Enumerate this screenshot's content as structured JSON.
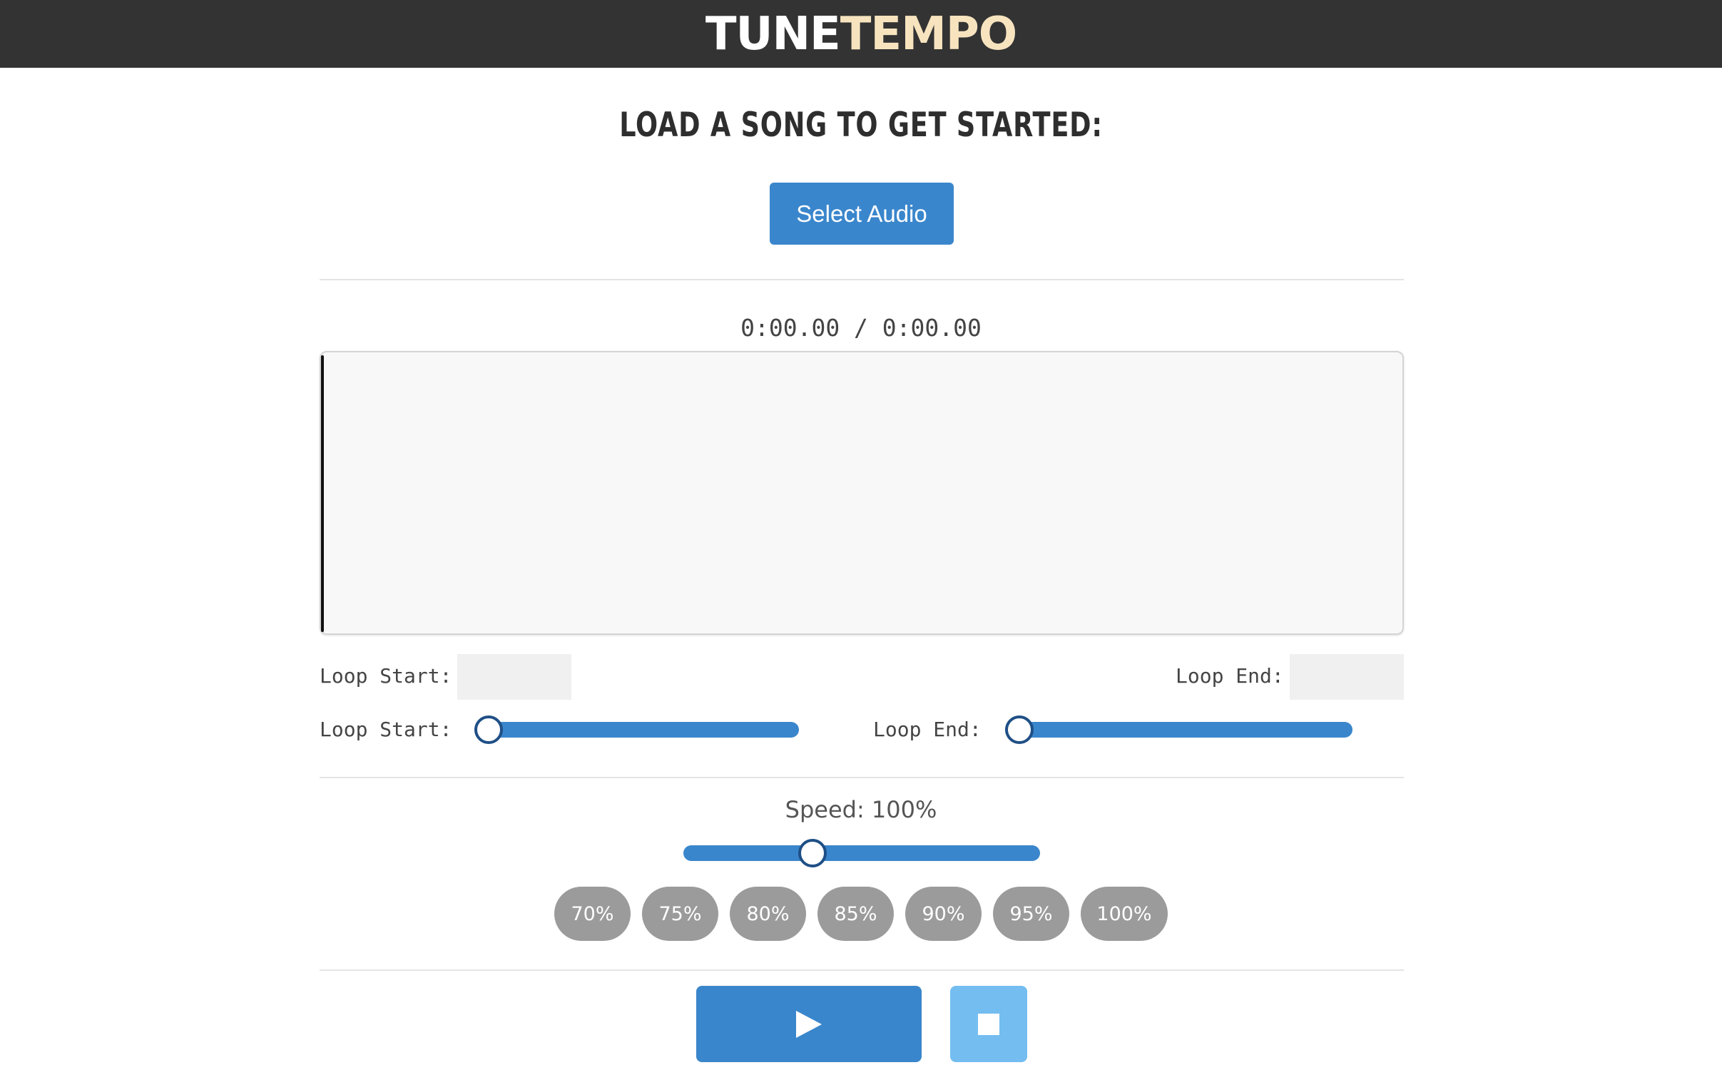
{
  "header": {
    "logo_part1": "TUNE",
    "logo_part2": "TEMPO"
  },
  "main": {
    "heading": "LOAD A SONG TO GET STARTED:",
    "select_button": "Select Audio",
    "time_display": "0:00.00 / 0:00.00"
  },
  "loop": {
    "start_field_label": "Loop Start:",
    "end_field_label": "Loop End:",
    "start_field_value": "",
    "end_field_value": "",
    "start_slider_label": "Loop Start:",
    "end_slider_label": "Loop End:",
    "start_slider_value": 0,
    "end_slider_value": 0
  },
  "speed": {
    "label": "Speed: 100%",
    "slider_fraction": 0.35,
    "presets": [
      "70%",
      "75%",
      "80%",
      "85%",
      "90%",
      "95%",
      "100%"
    ]
  },
  "controls": {
    "play_icon": "play-icon",
    "stop_icon": "stop-icon"
  },
  "colors": {
    "header_bg": "#333333",
    "logo_accent": "#f7e4bf",
    "primary": "#3a86cc",
    "stop_button": "#74bdf0",
    "preset_bg": "#9b9b9b"
  }
}
